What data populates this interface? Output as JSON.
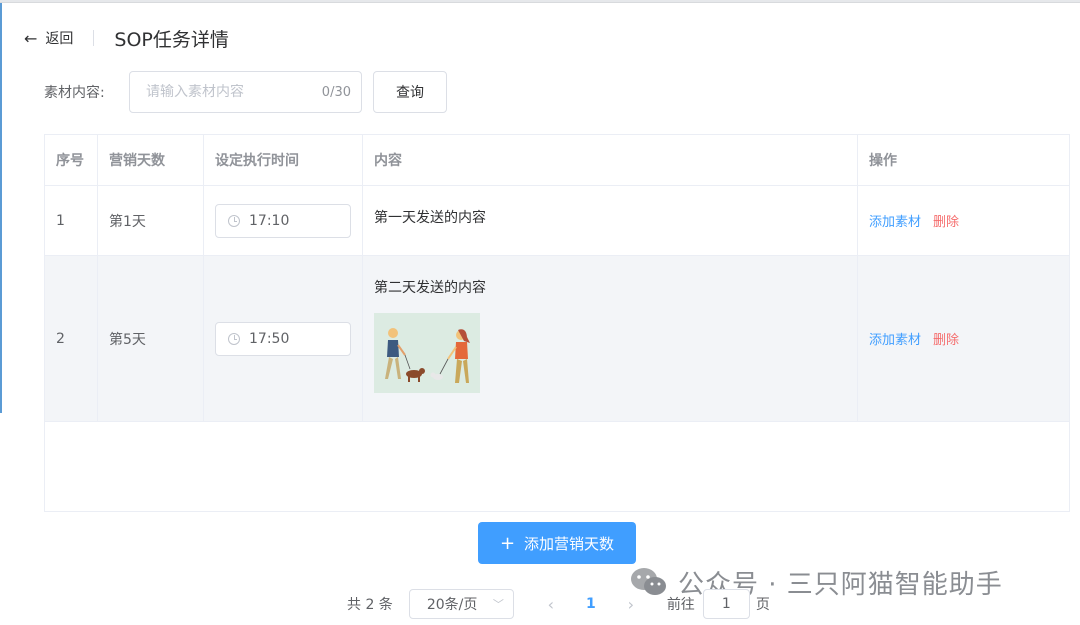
{
  "header": {
    "back_label": "返回",
    "title": "SOP任务详情"
  },
  "search": {
    "label": "素材内容:",
    "placeholder": "请输入素材内容",
    "count": "0/30",
    "button": "查询"
  },
  "table": {
    "columns": [
      "序号",
      "营销天数",
      "设定执行时间",
      "内容",
      "操作"
    ],
    "rows": [
      {
        "index": "1",
        "day": "第1天",
        "time": "17:10",
        "content": "第一天发送的内容",
        "has_image": false,
        "add": "添加素材",
        "delete": "删除"
      },
      {
        "index": "2",
        "day": "第5天",
        "time": "17:50",
        "content": "第二天发送的内容",
        "has_image": true,
        "add": "添加素材",
        "delete": "删除"
      }
    ]
  },
  "add_button": {
    "label": "添加营销天数"
  },
  "pagination": {
    "total": "共 2 条",
    "page_size": "20条/页",
    "current_page": "1",
    "goto_label": "前往",
    "goto_value": "1",
    "page_suffix": "页"
  },
  "watermark": {
    "text": "公众号 · 三只阿猫智能助手"
  },
  "colors": {
    "primary": "#409eff",
    "danger": "#f56c6c",
    "row_highlight": "#f3f5f8"
  }
}
